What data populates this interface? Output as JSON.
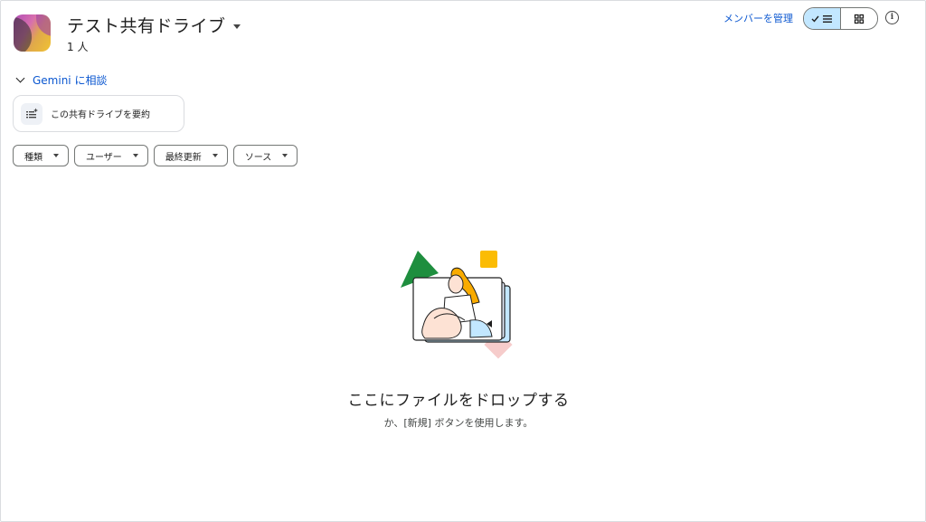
{
  "header": {
    "title": "テスト共有ドライブ",
    "member_count": "1 人",
    "manage_members": "メンバーを管理"
  },
  "view_toggle": {
    "list_selected": true
  },
  "gemini": {
    "label": "Gemini に相談",
    "summarize": "この共有ドライブを要約"
  },
  "filters": [
    {
      "label": "種類"
    },
    {
      "label": "ユーザー"
    },
    {
      "label": "最終更新"
    },
    {
      "label": "ソース"
    }
  ],
  "empty_state": {
    "title": "ここにファイルをドロップする",
    "subtitle": "か、[新規] ボタンを使用します。"
  },
  "colors": {
    "accent": "#0b57d0",
    "toggle_selected": "#c2e7ff",
    "illustration_green": "#1e8e3e",
    "illustration_yellow": "#fbbc04",
    "illustration_pink": "#f6cccb",
    "illustration_blue": "#c2e7ff"
  },
  "icons": {
    "drive_avatar": "drive-avatar",
    "title_menu": "caret-down-icon",
    "list_view": "list-view-icon",
    "grid_view": "grid-view-icon",
    "info": "info-icon",
    "gemini_collapse": "chevron-down-icon",
    "summarize": "summarize-icon"
  }
}
